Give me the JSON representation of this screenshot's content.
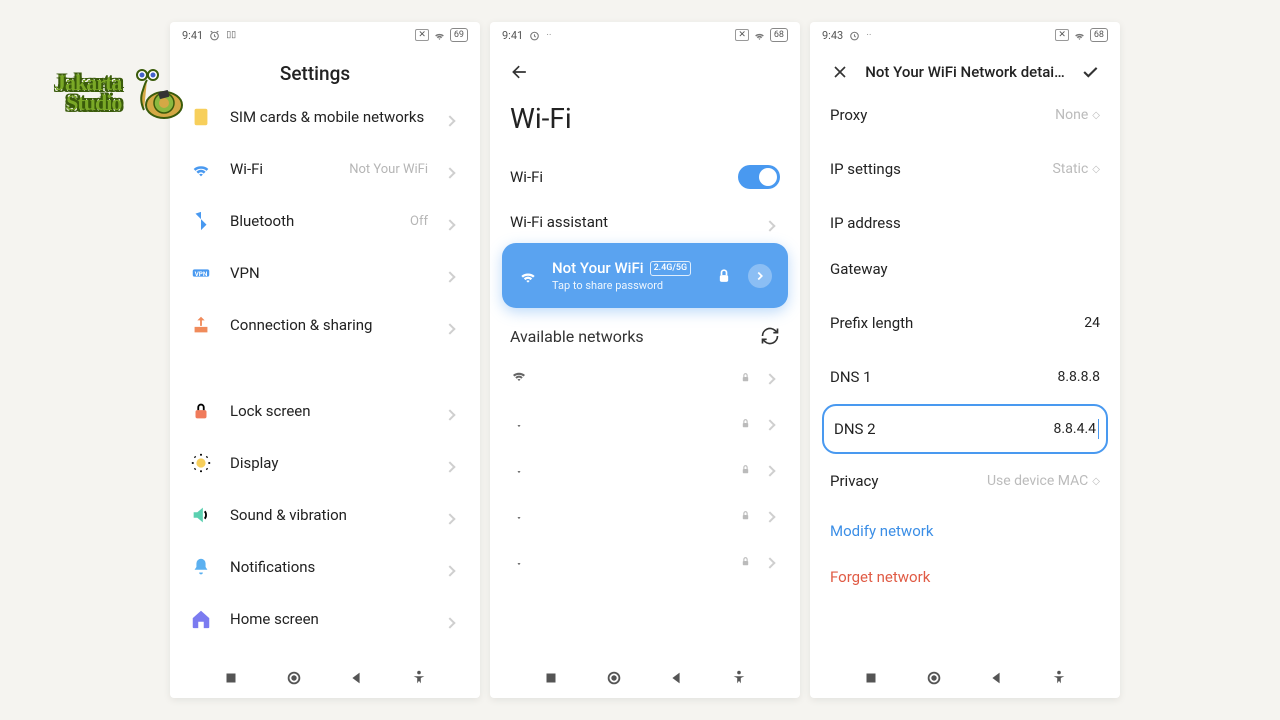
{
  "logo": {
    "line1": "Jakarta",
    "line2": "Studio"
  },
  "phone1": {
    "status": {
      "time": "9:41",
      "battery": "69"
    },
    "title": "Settings",
    "items": [
      {
        "icon": "sim",
        "color": "#f7cf5b",
        "label": "SIM cards & mobile networks",
        "value": ""
      },
      {
        "icon": "wifi",
        "color": "#4999f0",
        "label": "Wi-Fi",
        "value": "Not Your WiFi"
      },
      {
        "icon": "bluetooth",
        "color": "#4999f0",
        "label": "Bluetooth",
        "value": "Off"
      },
      {
        "icon": "vpn",
        "color": "#4999f0",
        "label": "VPN",
        "value": ""
      },
      {
        "icon": "share",
        "color": "#f08b5b",
        "label": "Connection & sharing",
        "value": ""
      },
      {
        "icon": "lock",
        "color": "#f07b5b",
        "label": "Lock screen",
        "value": "",
        "group": true
      },
      {
        "icon": "display",
        "color": "#f7cf5b",
        "label": "Display",
        "value": ""
      },
      {
        "icon": "sound",
        "color": "#5bd0b0",
        "label": "Sound & vibration",
        "value": ""
      },
      {
        "icon": "bell",
        "color": "#5bb0f0",
        "label": "Notifications",
        "value": ""
      },
      {
        "icon": "home",
        "color": "#7b7bf0",
        "label": "Home screen",
        "value": ""
      }
    ]
  },
  "phone2": {
    "status": {
      "time": "9:41",
      "battery": "68"
    },
    "title": "Wi-Fi",
    "wifi_row": "Wi-Fi",
    "assistant_row": "Wi-Fi assistant",
    "connected": {
      "name": "Not Your WiFi",
      "badge": "2.4G/5G",
      "subtitle": "Tap to share password"
    },
    "available_title": "Available networks"
  },
  "phone3": {
    "status": {
      "time": "9:43",
      "battery": "68"
    },
    "title": "Not Your WiFi Network detai…",
    "rows": {
      "proxy": {
        "label": "Proxy",
        "value": "None"
      },
      "ip_settings": {
        "label": "IP settings",
        "value": "Static"
      },
      "ip_address": {
        "label": "IP address",
        "value": ""
      },
      "gateway": {
        "label": "Gateway",
        "value": ""
      },
      "prefix": {
        "label": "Prefix length",
        "value": "24"
      },
      "dns1": {
        "label": "DNS 1",
        "value": "8.8.8.8"
      },
      "dns2": {
        "label": "DNS 2",
        "value": "8.8.4.4"
      },
      "privacy": {
        "label": "Privacy",
        "value": "Use device MAC"
      }
    },
    "modify": "Modify network",
    "forget": "Forget network"
  }
}
